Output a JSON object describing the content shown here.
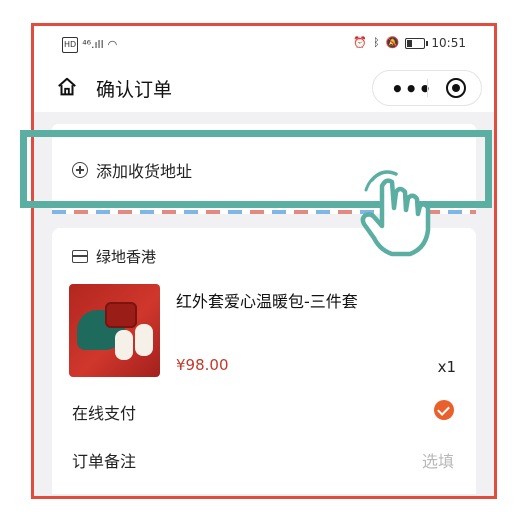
{
  "status_bar": {
    "signal_text": "⁴⁶.ıll",
    "time": "10:51"
  },
  "nav": {
    "title": "确认订单",
    "home_icon": "home-icon",
    "more_icon": "more-icon",
    "close_icon": "close-icon"
  },
  "address": {
    "add_label": "添加收货地址",
    "icon": "plus-circle-icon"
  },
  "order": {
    "store_name": "绿地香港",
    "store_icon": "store-icon",
    "product": {
      "name": "红外套爱心温暖包-三件套",
      "price": "¥98.00",
      "quantity": "x1"
    },
    "payment_label": "在线支付",
    "payment_selected": true,
    "note_label": "订单备注",
    "note_placeholder": "选填"
  },
  "colors": {
    "frame_border": "#e14c3f",
    "highlight_box": "#5aaea2",
    "accent_orange": "#e8612c",
    "price_red": "#c0392b"
  }
}
